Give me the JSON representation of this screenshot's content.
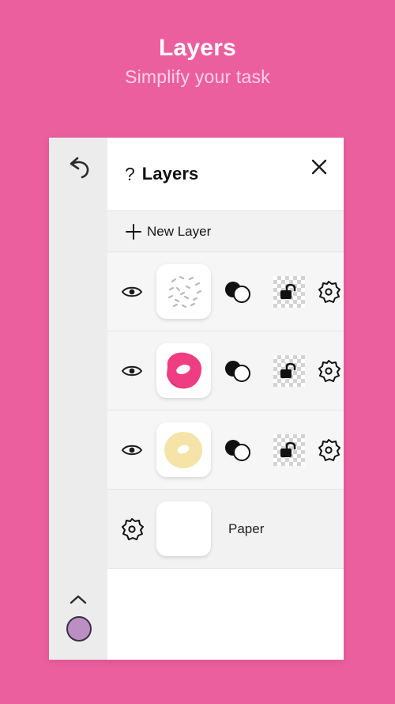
{
  "promo": {
    "title": "Layers",
    "subtitle": "Simplify your task"
  },
  "theme": {
    "background_pink": "#ec5f9f",
    "subtitle_color": "#ffd2e6",
    "panel_bg": "#ffffff",
    "row_bg": "#f5f5f5",
    "rail_bg": "#ececed",
    "swatch_color": "#bb8fc4",
    "donut_icing_pink": "#ee3d80",
    "donut_dough_cream": "#f5e3a8"
  },
  "rail": {
    "undo_icon": "undo-arrow-icon",
    "chevron_icon": "chevron-up-icon",
    "color_swatch": "#bb8fc4"
  },
  "panel": {
    "help_icon": "question-mark-icon",
    "title": "Layers",
    "close_icon": "close-icon",
    "new_layer": {
      "icon": "plus-icon",
      "label": "New Layer"
    }
  },
  "layers": [
    {
      "name": "sprinkles-layer",
      "visibility_icon": "eye-icon",
      "visible": true,
      "thumbnail": "sprinkles-thumbnail",
      "blend_icon": "blend-mode-icon",
      "lock_icon": "unlock-icon",
      "locked": false,
      "settings_icon": "gear-icon"
    },
    {
      "name": "icing-layer",
      "visibility_icon": "eye-icon",
      "visible": true,
      "thumbnail": "pink-donut-thumbnail",
      "blend_icon": "blend-mode-icon",
      "lock_icon": "unlock-icon",
      "locked": false,
      "settings_icon": "gear-icon"
    },
    {
      "name": "dough-layer",
      "visibility_icon": "eye-icon",
      "visible": true,
      "thumbnail": "cream-donut-thumbnail",
      "blend_icon": "blend-mode-icon",
      "lock_icon": "unlock-icon",
      "locked": false,
      "settings_icon": "gear-icon"
    }
  ],
  "paper": {
    "settings_icon": "gear-icon",
    "thumbnail": "blank-paper-thumbnail",
    "label": "Paper"
  }
}
